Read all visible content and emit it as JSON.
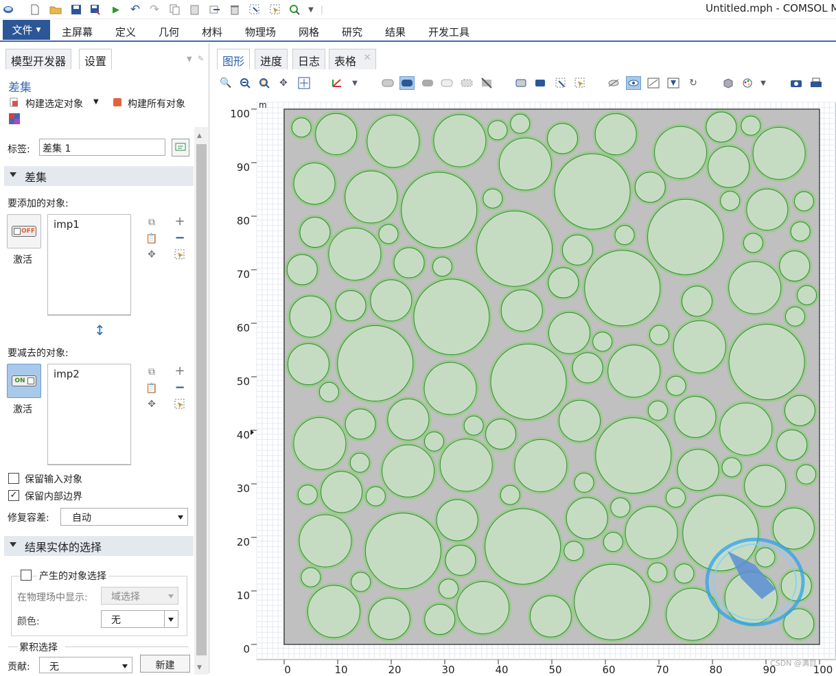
{
  "window": {
    "title": "Untitled.mph - COMSOL Multiphysics"
  },
  "ribbon": {
    "file_label": "文件",
    "tabs": [
      "主屏幕",
      "定义",
      "几何",
      "材料",
      "物理场",
      "网格",
      "研究",
      "结果",
      "开发工具"
    ]
  },
  "left_panel": {
    "tabs": [
      "模型开发器",
      "设置"
    ],
    "heading": "差集",
    "build_selected": "构建选定对象",
    "build_all": "构建所有对象",
    "label_caption": "标签:",
    "label_value": "差集 1",
    "section_difference": "差集",
    "add_objects_caption": "要添加的对象:",
    "add_objects_item": "imp1",
    "add_toggle_text": "OFF",
    "add_activate": "激活",
    "subtract_objects_caption": "要减去的对象:",
    "subtract_objects_item": "imp2",
    "subtract_toggle_text": "ON",
    "subtract_activate": "激活",
    "keep_input": "保留输入对象",
    "keep_input_checked": false,
    "keep_interior": "保留内部边界",
    "keep_interior_checked": true,
    "repair_tol_caption": "修复容差:",
    "repair_tol_value": "自动",
    "section_result": "结果实体的选择",
    "generate_selection": "产生的对象选择",
    "show_in_physics_caption": "在物理场中显示:",
    "show_in_physics_value": "域选择",
    "color_caption": "颜色:",
    "color_value": "无",
    "cumulative_title": "累积选择",
    "contribute_caption": "贡献:",
    "contribute_value": "无",
    "new_button": "新建"
  },
  "graphics": {
    "tabs": [
      "图形",
      "进度",
      "日志",
      "表格"
    ],
    "unit_label": "m",
    "y_ticks": [
      "100",
      "90",
      "80",
      "70",
      "60",
      "50",
      "40",
      "30",
      "20",
      "10",
      "0"
    ],
    "x_ticks": [
      "0",
      "10",
      "20",
      "30",
      "40",
      "50",
      "60",
      "70",
      "80",
      "90",
      "100"
    ],
    "domain_color": "#c0c0c0",
    "circle_fill": "#c5dcc2",
    "circle_stroke": "#2e8b2e",
    "watermark": "CSDN @满目"
  }
}
